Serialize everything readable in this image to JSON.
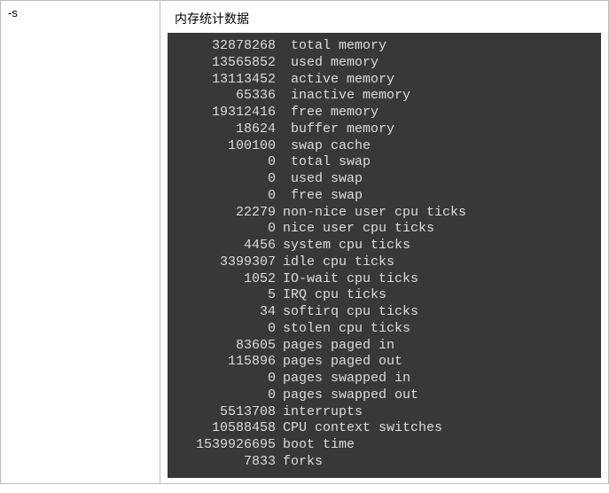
{
  "leftCell": {
    "flag": "-s"
  },
  "rightCell": {
    "description": "内存统计数据",
    "terminal": {
      "lines": [
        {
          "value": "32878268",
          "label": " total memory"
        },
        {
          "value": "13565852",
          "label": " used memory"
        },
        {
          "value": "13113452",
          "label": " active memory"
        },
        {
          "value": "65336",
          "label": " inactive memory"
        },
        {
          "value": "19312416",
          "label": " free memory"
        },
        {
          "value": "18624",
          "label": " buffer memory"
        },
        {
          "value": "100100",
          "label": " swap cache"
        },
        {
          "value": "0",
          "label": " total swap"
        },
        {
          "value": "0",
          "label": " used swap"
        },
        {
          "value": "0",
          "label": " free swap"
        },
        {
          "value": "22279",
          "label": "non-nice user cpu ticks"
        },
        {
          "value": "0",
          "label": "nice user cpu ticks"
        },
        {
          "value": "4456",
          "label": "system cpu ticks"
        },
        {
          "value": "3399307",
          "label": "idle cpu ticks"
        },
        {
          "value": "1052",
          "label": "IO-wait cpu ticks"
        },
        {
          "value": "5",
          "label": "IRQ cpu ticks"
        },
        {
          "value": "34",
          "label": "softirq cpu ticks"
        },
        {
          "value": "0",
          "label": "stolen cpu ticks"
        },
        {
          "value": "83605",
          "label": "pages paged in"
        },
        {
          "value": "115896",
          "label": "pages paged out"
        },
        {
          "value": "0",
          "label": "pages swapped in"
        },
        {
          "value": "0",
          "label": "pages swapped out"
        },
        {
          "value": "5513708",
          "label": "interrupts"
        },
        {
          "value": "10588458",
          "label": "CPU context switches"
        },
        {
          "value": "1539926695",
          "label": "boot time"
        },
        {
          "value": "7833",
          "label": "forks"
        }
      ]
    }
  }
}
